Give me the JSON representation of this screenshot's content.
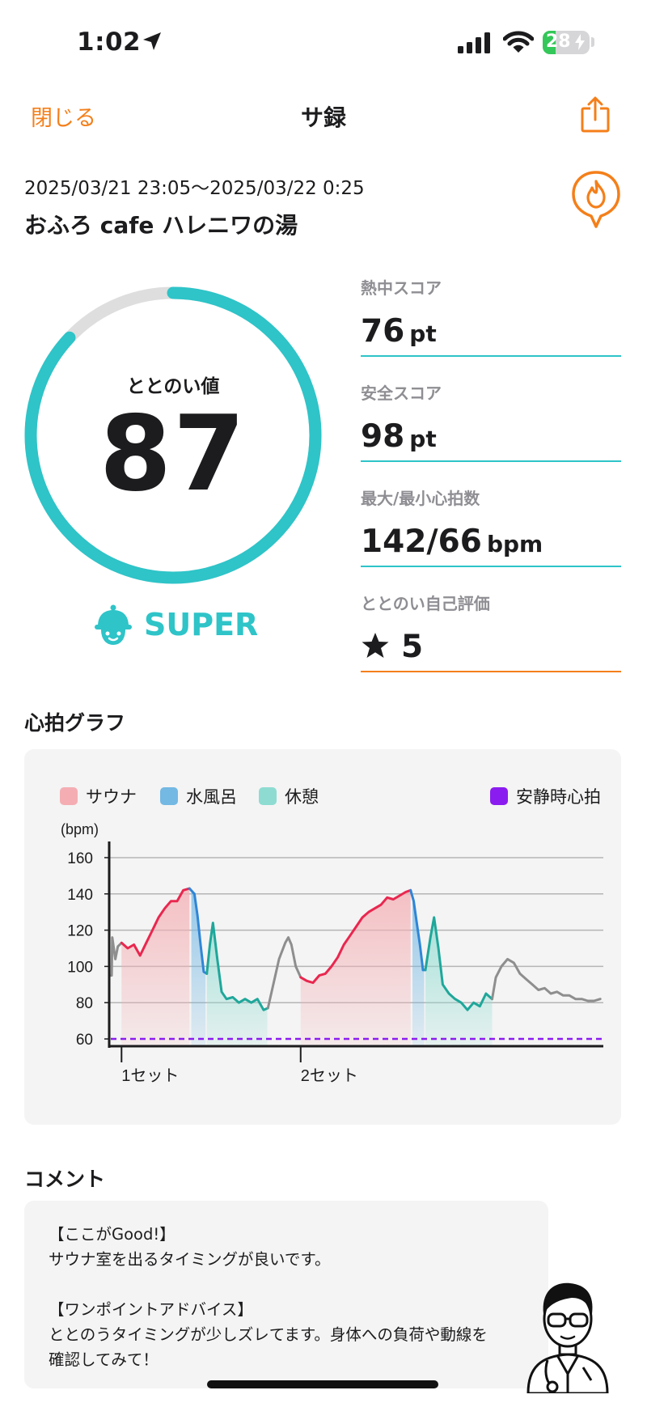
{
  "status_bar": {
    "time": "1:02",
    "battery_level": 28,
    "icons": [
      "location-arrow-icon",
      "cellular-signal-icon",
      "wifi-icon",
      "battery-charging-icon"
    ]
  },
  "nav": {
    "close_label": "閉じる",
    "title": "サ録",
    "share_icon": "share-icon"
  },
  "session": {
    "datetime": "2025/03/21 23:05～2025/03/22 0:25",
    "facility": "おふろ cafe ハレニワの湯",
    "badge_icon": "fire-pin-icon"
  },
  "totonoi": {
    "label": "ととのい値",
    "value": "87",
    "score_fraction": 0.87,
    "rank_icon": "helmet-face-icon",
    "rank": "SUPER"
  },
  "metrics": [
    {
      "label": "熱中スコア",
      "value": "76",
      "unit": "pt"
    },
    {
      "label": "安全スコア",
      "value": "98",
      "unit": "pt"
    },
    {
      "label": "最大/最小心拍数",
      "value": "142/66",
      "unit": "bpm"
    },
    {
      "label": "ととのい自己評価",
      "value": "5",
      "icon": "star-icon"
    }
  ],
  "chart_section_title": "心拍グラフ",
  "colors": {
    "accent_orange": "#f47f1a",
    "teal": "#2ec4c8",
    "sauna": "#e9274f",
    "water_bath": "#2f86d6",
    "rest": "#1fa79a",
    "resting_hr": "#8b1cf0",
    "other": "#8e8e8e"
  },
  "chart_data": {
    "type": "line",
    "legend": [
      {
        "name": "サウナ",
        "color": "#f4aeb3"
      },
      {
        "name": "水風呂",
        "color": "#74b8e4"
      },
      {
        "name": "休憩",
        "color": "#8edcd1"
      },
      {
        "name": "安静時心拍",
        "color": "#8b1cf0"
      }
    ],
    "y_unit": "(bpm)",
    "yticks": [
      60,
      80,
      100,
      120,
      140,
      160
    ],
    "ylim": [
      56,
      164
    ],
    "xlim": [
      0,
      80
    ],
    "x_markers": [
      {
        "x": 2,
        "label": "1セット"
      },
      {
        "x": 31,
        "label": "2セット"
      }
    ],
    "resting_hr": 60,
    "phases": [
      {
        "kind": "sauna",
        "start": 2,
        "end": 13
      },
      {
        "kind": "water",
        "start": 13.3,
        "end": 15.6
      },
      {
        "kind": "rest",
        "start": 15.8,
        "end": 25.6
      },
      {
        "kind": "sauna",
        "start": 31,
        "end": 48.8
      },
      {
        "kind": "water",
        "start": 49.1,
        "end": 51
      },
      {
        "kind": "rest",
        "start": 51.2,
        "end": 62
      }
    ],
    "series": [
      {
        "kind": "other",
        "points": [
          [
            0,
            95
          ],
          [
            0.4,
            95
          ],
          [
            0.5,
            116
          ],
          [
            1.0,
            104
          ],
          [
            1.4,
            111
          ],
          [
            2,
            113
          ]
        ]
      },
      {
        "kind": "sauna",
        "points": [
          [
            2,
            113
          ],
          [
            3,
            110
          ],
          [
            4,
            112
          ],
          [
            5,
            106
          ],
          [
            6,
            113
          ],
          [
            7,
            120
          ],
          [
            8,
            127
          ],
          [
            9,
            132
          ],
          [
            10,
            136
          ],
          [
            11,
            136
          ],
          [
            12,
            142
          ],
          [
            13,
            143
          ]
        ]
      },
      {
        "kind": "water",
        "points": [
          [
            13,
            143
          ],
          [
            13.8,
            140
          ],
          [
            14.3,
            128
          ],
          [
            14.8,
            112
          ],
          [
            15.3,
            97
          ],
          [
            15.8,
            96
          ]
        ]
      },
      {
        "kind": "rest",
        "points": [
          [
            15.8,
            96
          ],
          [
            16.3,
            112
          ],
          [
            16.8,
            124
          ],
          [
            17.5,
            104
          ],
          [
            18.2,
            86
          ],
          [
            19,
            82
          ],
          [
            20,
            83
          ],
          [
            21,
            80
          ],
          [
            22,
            82
          ],
          [
            23,
            80
          ],
          [
            24,
            82
          ],
          [
            25,
            76
          ],
          [
            25.7,
            77
          ]
        ]
      },
      {
        "kind": "other",
        "points": [
          [
            25.7,
            77
          ],
          [
            26.5,
            89
          ],
          [
            27.5,
            104
          ],
          [
            28.5,
            113
          ],
          [
            29,
            116
          ],
          [
            29.5,
            112
          ],
          [
            30.2,
            100
          ],
          [
            31,
            94
          ]
        ]
      },
      {
        "kind": "sauna",
        "points": [
          [
            31,
            94
          ],
          [
            32,
            92
          ],
          [
            33,
            91
          ],
          [
            34,
            95
          ],
          [
            35,
            96
          ],
          [
            36,
            100
          ],
          [
            37,
            105
          ],
          [
            38,
            112
          ],
          [
            39,
            117
          ],
          [
            40,
            122
          ],
          [
            41,
            127
          ],
          [
            42,
            130
          ],
          [
            43,
            132
          ],
          [
            44,
            134
          ],
          [
            45,
            138
          ],
          [
            46,
            137
          ],
          [
            47,
            139
          ],
          [
            48,
            141
          ],
          [
            48.8,
            142
          ]
        ]
      },
      {
        "kind": "water",
        "points": [
          [
            48.8,
            142
          ],
          [
            49.3,
            136
          ],
          [
            49.8,
            124
          ],
          [
            50.3,
            112
          ],
          [
            50.8,
            98
          ],
          [
            51.2,
            98
          ]
        ]
      },
      {
        "kind": "rest",
        "points": [
          [
            51.2,
            98
          ],
          [
            52,
            116
          ],
          [
            52.6,
            127
          ],
          [
            53.3,
            110
          ],
          [
            54,
            90
          ],
          [
            55,
            85
          ],
          [
            56,
            82
          ],
          [
            57,
            80
          ],
          [
            58,
            76
          ],
          [
            59,
            80
          ],
          [
            60,
            78
          ],
          [
            61,
            85
          ],
          [
            62,
            82
          ]
        ]
      },
      {
        "kind": "other",
        "points": [
          [
            62,
            82
          ],
          [
            62.6,
            94
          ],
          [
            63.5,
            100
          ],
          [
            64.5,
            104
          ],
          [
            65.5,
            102
          ],
          [
            66.5,
            96
          ],
          [
            67.5,
            93
          ],
          [
            68.5,
            90
          ],
          [
            69.5,
            87
          ],
          [
            70.5,
            88
          ],
          [
            71.5,
            85
          ],
          [
            72.5,
            86
          ],
          [
            73.5,
            84
          ],
          [
            74.5,
            84
          ],
          [
            75.5,
            82
          ],
          [
            76.5,
            82
          ],
          [
            77.5,
            81
          ],
          [
            78.5,
            81
          ],
          [
            79.5,
            82
          ]
        ]
      }
    ]
  },
  "comment": {
    "title": "コメント",
    "text": "【ここがGood!】\nサウナ室を出るタイミングが良いです。\n\n【ワンポイントアドバイス】\nととのうタイミングが少しズレてます。身体への負荷や動線を\n確認してみて！",
    "avatar_icon": "doctor-avatar-icon"
  }
}
